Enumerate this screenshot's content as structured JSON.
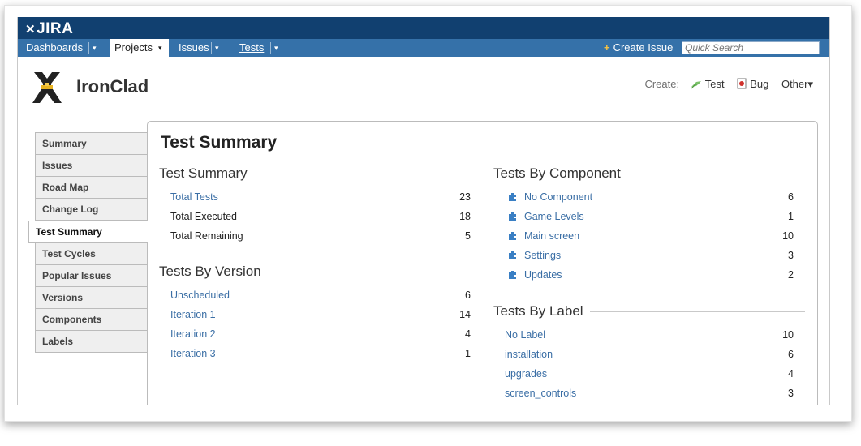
{
  "app": {
    "logo_text": "JIRA",
    "logo_mark": "✕"
  },
  "nav": {
    "items": [
      {
        "label": "Dashboards"
      },
      {
        "label": "Projects"
      },
      {
        "label": "Issues"
      },
      {
        "label": "Tests"
      }
    ],
    "caret": "▾",
    "create_issue": "Create Issue",
    "create_issue_icon": "+",
    "search_placeholder": "Quick Search"
  },
  "project": {
    "name": "IronClad",
    "create_label": "Create:",
    "create_items": [
      {
        "label": "Test",
        "icon": "test-icon"
      },
      {
        "label": "Bug",
        "icon": "bug-icon"
      },
      {
        "label": "Other▾",
        "icon": ""
      }
    ]
  },
  "sidebar": {
    "items": [
      {
        "label": "Summary"
      },
      {
        "label": "Issues"
      },
      {
        "label": "Road Map"
      },
      {
        "label": "Change Log"
      },
      {
        "label": "Test Summary",
        "active": true
      },
      {
        "label": "Test Cycles"
      },
      {
        "label": "Popular Issues"
      },
      {
        "label": "Versions"
      },
      {
        "label": "Components"
      },
      {
        "label": "Labels"
      }
    ]
  },
  "main": {
    "title": "Test Summary",
    "test_summary": {
      "heading": "Test Summary",
      "rows": [
        {
          "name": "Total Tests",
          "value": "23",
          "link": true
        },
        {
          "name": "Total Executed",
          "value": "18",
          "link": false
        },
        {
          "name": "Total Remaining",
          "value": "5",
          "link": false
        }
      ]
    },
    "by_version": {
      "heading": "Tests By Version",
      "rows": [
        {
          "name": "Unscheduled",
          "value": "6"
        },
        {
          "name": "Iteration 1",
          "value": "14"
        },
        {
          "name": "Iteration 2",
          "value": "4"
        },
        {
          "name": "Iteration 3",
          "value": "1"
        }
      ]
    },
    "by_component": {
      "heading": "Tests By Component",
      "rows": [
        {
          "name": "No Component",
          "value": "6"
        },
        {
          "name": "Game Levels",
          "value": "1"
        },
        {
          "name": "Main screen",
          "value": "10"
        },
        {
          "name": "Settings",
          "value": "3"
        },
        {
          "name": "Updates",
          "value": "2"
        }
      ]
    },
    "by_label": {
      "heading": "Tests By Label",
      "rows": [
        {
          "name": "No Label",
          "value": "10"
        },
        {
          "name": "installation",
          "value": "6"
        },
        {
          "name": "upgrades",
          "value": "4"
        },
        {
          "name": "screen_controls",
          "value": "3"
        }
      ]
    }
  },
  "colors": {
    "header": "#114070",
    "navbar": "#3571a9",
    "link": "#3a6ea5"
  }
}
